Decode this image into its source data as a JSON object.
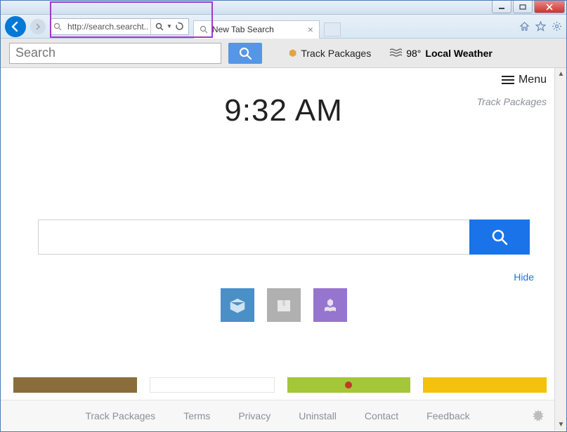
{
  "window": {
    "title": ""
  },
  "browser": {
    "url": "http://search.searcht...",
    "tab_title": "New Tab Search"
  },
  "toolbar": {
    "search_placeholder": "Search",
    "track_label": "Track Packages",
    "temperature": "98°",
    "weather_label": "Local Weather"
  },
  "page": {
    "menu_label": "Menu",
    "clock_time": "9:32 AM",
    "track_link": "Track Packages",
    "hide_label": "Hide",
    "tiles": [
      {
        "name": "package-tile",
        "color": "blue"
      },
      {
        "name": "box-tile",
        "color": "gray"
      },
      {
        "name": "hands-tile",
        "color": "purple"
      }
    ],
    "strips": [
      "#8a6d3b",
      "#ffffff",
      "#a4c639",
      "#f4c20d"
    ]
  },
  "footer": {
    "links": [
      "Track Packages",
      "Terms",
      "Privacy",
      "Uninstall",
      "Contact",
      "Feedback"
    ]
  }
}
